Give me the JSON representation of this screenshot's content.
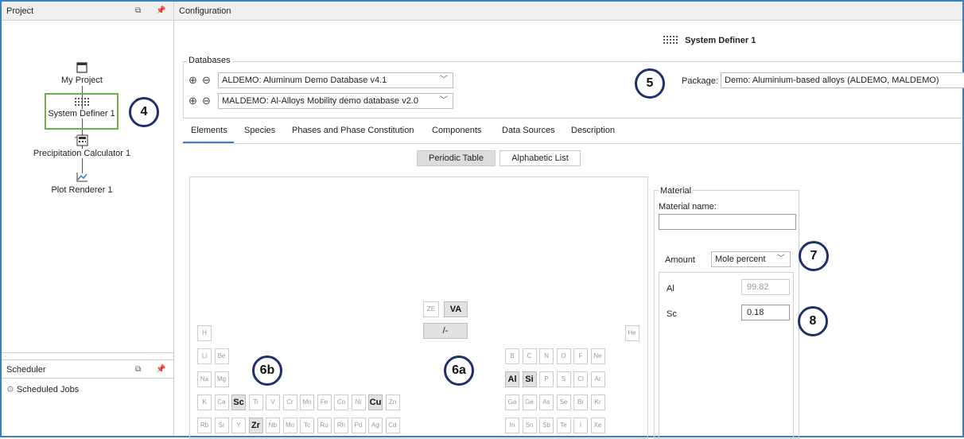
{
  "project_panel": {
    "title": "Project"
  },
  "tree": {
    "my_project": "My Project",
    "system_definer": "System Definer 1",
    "precipitation_calculator": "Precipitation Calculator 1",
    "plot_renderer": "Plot Renderer 1"
  },
  "scheduler_panel": {
    "title": "Scheduler",
    "item": "Scheduled Jobs"
  },
  "config": {
    "title": "Configuration",
    "system_definer_title": "System Definer 1"
  },
  "databases": {
    "group_label": "Databases",
    "db1": "ALDEMO: Aluminum Demo Database v4.1",
    "db2": "MALDEMO: Al-Alloys Mobility demo database v2.0",
    "package_label": "Package:",
    "package_value": "Demo: Aluminium-based alloys (ALDEMO, MALDEMO)"
  },
  "tabs": [
    "Elements",
    "Species",
    "Phases and Phase Constitution",
    "Components",
    "Data Sources",
    "Description"
  ],
  "view_toggle": {
    "periodic": "Periodic Table",
    "alphabetic": "Alphabetic List"
  },
  "special": {
    "ze": "ZE",
    "va": "VA",
    "slash": "/-"
  },
  "periodic": {
    "row1": [
      "H",
      "He"
    ],
    "row2": [
      "Li",
      "Be",
      "B",
      "C",
      "N",
      "O",
      "F",
      "Ne"
    ],
    "row3": [
      "Na",
      "Mg",
      "Al",
      "Si",
      "P",
      "S",
      "Cl",
      "Ar"
    ],
    "row4": [
      "K",
      "Ca",
      "Sc",
      "Ti",
      "V",
      "Cr",
      "Mn",
      "Fe",
      "Co",
      "Ni",
      "Cu",
      "Zn",
      "Ga",
      "Ge",
      "As",
      "Se",
      "Br",
      "Kr"
    ],
    "row5": [
      "Rb",
      "Sr",
      "Y",
      "Zr",
      "Nb",
      "Mo",
      "Tc",
      "Ru",
      "Rh",
      "Pd",
      "Ag",
      "Cd",
      "In",
      "Sn",
      "Sb",
      "Te",
      "I",
      "Xe"
    ],
    "selected": [
      "Al",
      "Si",
      "Sc",
      "Cu",
      "Zr"
    ]
  },
  "material": {
    "group_label": "Material",
    "name_label": "Material name:",
    "name_value": "",
    "amount_label": "Amount",
    "amount_unit": "Mole percent",
    "rows": [
      {
        "element": "Al",
        "value": "99.82"
      },
      {
        "element": "Sc",
        "value": "0.18"
      }
    ]
  },
  "callouts": {
    "c4": "4",
    "c5": "5",
    "c6a": "6a",
    "c6b": "6b",
    "c7": "7",
    "c8": "8"
  },
  "colors": {
    "accent_border": "#3b7fc4",
    "callout_ring": "#1f2f6e",
    "selected_node": "#6ab04c",
    "tab_underline": "#3b7fc4"
  }
}
